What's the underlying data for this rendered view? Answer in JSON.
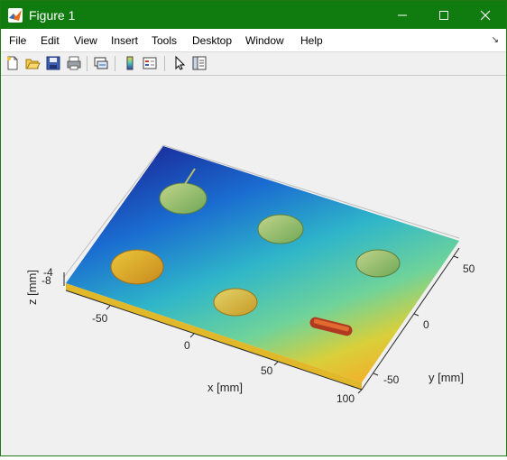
{
  "window": {
    "title": "Figure 1",
    "minimize_icon": "minimize-icon",
    "maximize_icon": "maximize-icon",
    "close_icon": "close-icon"
  },
  "menubar": {
    "items": [
      "File",
      "Edit",
      "View",
      "Insert",
      "Tools",
      "Desktop",
      "Window",
      "Help"
    ]
  },
  "toolbar": {
    "icons": [
      "new-figure-icon",
      "open-file-icon",
      "save-icon",
      "print-icon",
      "link-plot-icon",
      "colorbar-icon",
      "legend-icon",
      "edit-plot-icon",
      "property-inspector-icon"
    ]
  },
  "axes": {
    "xlabel": "x [mm]",
    "ylabel": "y [mm]",
    "zlabel": "z [mm]",
    "x_ticks": [
      "-50",
      "0",
      "50",
      "100"
    ],
    "y_ticks": [
      "50",
      "0",
      "-50"
    ],
    "z_ticks": [
      "-4",
      "-6",
      "-8"
    ]
  },
  "colors": {
    "title_bar": "#107c10",
    "surface_low": "#1a3fa8",
    "surface_mid": "#4ec9b8",
    "surface_high": "#e8c23a",
    "coin": "#c8b43c"
  }
}
